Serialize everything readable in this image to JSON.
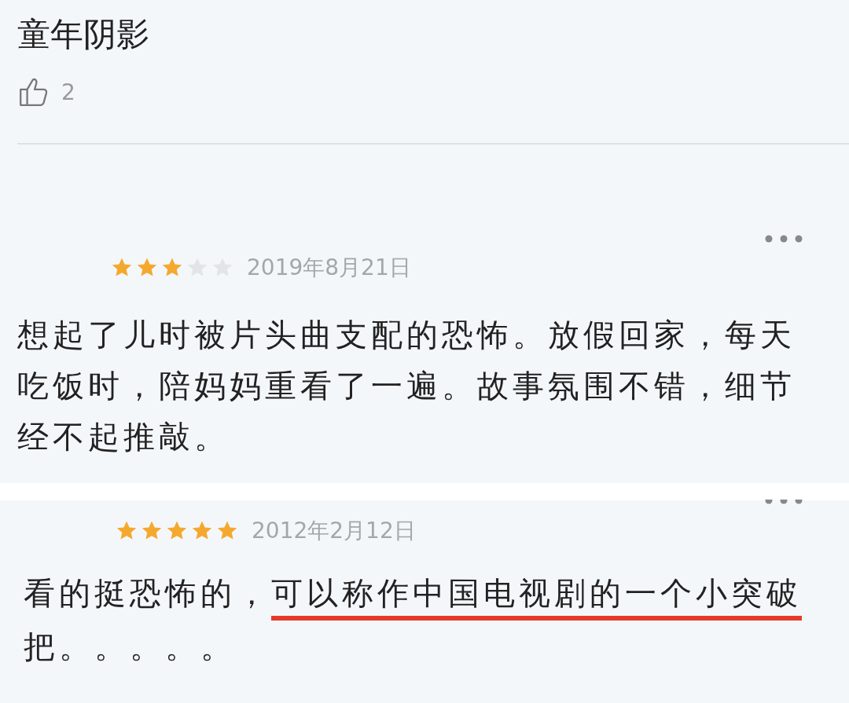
{
  "top_comment": {
    "text": "童年阴影",
    "likes": "2"
  },
  "reviews": [
    {
      "stars": 3,
      "date": "2019年8月21日",
      "lines": [
        [
          {
            "text": "想起了儿时被片头曲支配的恐怖。放假回家，每天",
            "underlined": false
          }
        ],
        [
          {
            "text": "吃饭时，陪妈妈重看了一遍。故事氛围不错，细节",
            "underlined": false
          }
        ],
        [
          {
            "text": "经不起推敲。",
            "underlined": false
          }
        ]
      ]
    },
    {
      "stars": 5,
      "date": "2012年2月12日",
      "lines": [
        [
          {
            "text": "看的挺恐怖的，",
            "underlined": false
          },
          {
            "text": "可以称作中国电视剧的一个小突破",
            "underlined": true
          }
        ],
        [
          {
            "text": "把。。。。。",
            "underlined": false
          }
        ]
      ]
    }
  ]
}
